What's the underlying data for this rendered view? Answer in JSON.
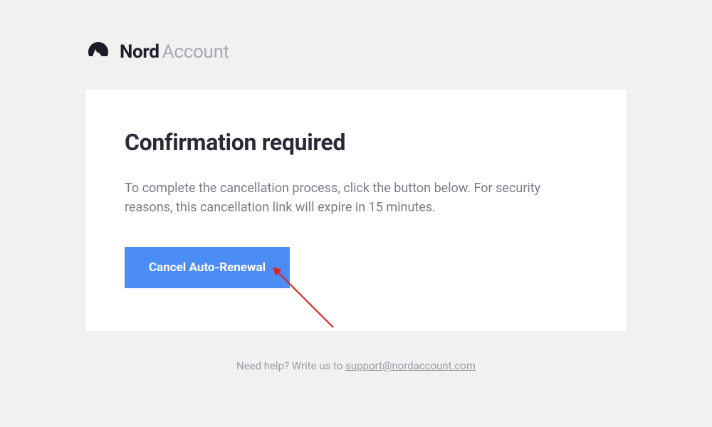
{
  "header": {
    "brand_bold": "Nord",
    "brand_light": "Account"
  },
  "card": {
    "title": "Confirmation required",
    "body": "To complete the cancellation process, click the button below. For security reasons, this cancellation link will expire in 15 minutes.",
    "cta_label": "Cancel Auto-Renewal"
  },
  "footer": {
    "prefix": "Need help? Write us to ",
    "link_text": "support@nordaccount.com"
  }
}
